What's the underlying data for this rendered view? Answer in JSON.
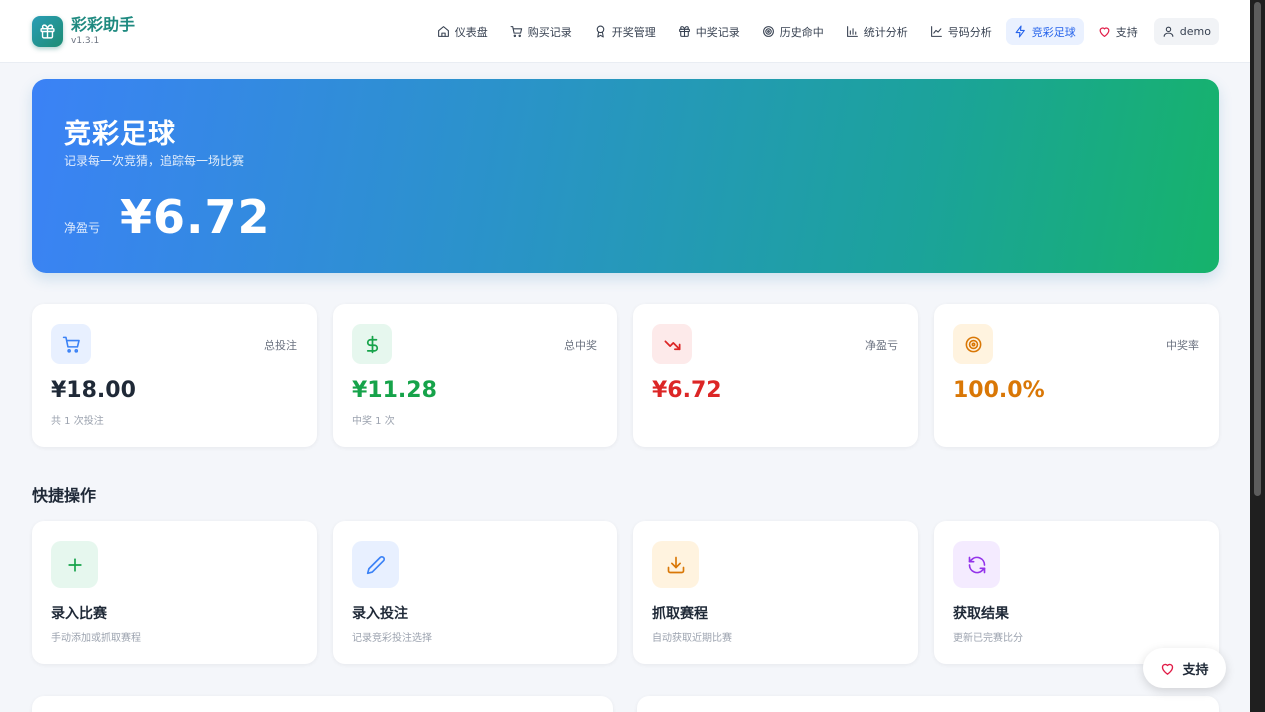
{
  "app": {
    "name": "彩彩助手",
    "version": "v1.3.1"
  },
  "nav": {
    "items": [
      {
        "label": "仪表盘",
        "icon": "home-icon"
      },
      {
        "label": "购买记录",
        "icon": "cart-icon"
      },
      {
        "label": "开奖管理",
        "icon": "award-icon"
      },
      {
        "label": "中奖记录",
        "icon": "gift-icon"
      },
      {
        "label": "历史命中",
        "icon": "target-icon"
      },
      {
        "label": "统计分析",
        "icon": "bar-chart-icon"
      },
      {
        "label": "号码分析",
        "icon": "line-chart-icon"
      },
      {
        "label": "竞彩足球",
        "icon": "lightning-icon",
        "active": true
      },
      {
        "label": "支持",
        "icon": "heart-icon"
      }
    ],
    "user": "demo"
  },
  "hero": {
    "title": "竞彩足球",
    "subtitle": "记录每一次竞猜，追踪每一场比赛",
    "net_label": "净盈亏",
    "net_value": "¥6.72"
  },
  "stats": [
    {
      "label": "总投注",
      "value": "¥18.00",
      "note": "共 1 次投注",
      "icon": "cart-icon",
      "color": "#1f2937"
    },
    {
      "label": "总中奖",
      "value": "¥11.28",
      "note": "中奖 1 次",
      "icon": "dollar-icon",
      "color": "#16a34a"
    },
    {
      "label": "净盈亏",
      "value": "¥6.72",
      "note": "",
      "icon": "trending-down-icon",
      "color": "#dc2626"
    },
    {
      "label": "中奖率",
      "value": "100.0%",
      "note": "",
      "icon": "target-icon",
      "color": "#d97706"
    }
  ],
  "quick_actions": {
    "title": "快捷操作",
    "items": [
      {
        "title": "录入比赛",
        "desc": "手动添加或抓取赛程",
        "icon": "plus-icon"
      },
      {
        "title": "录入投注",
        "desc": "记录竞彩投注选择",
        "icon": "pencil-icon"
      },
      {
        "title": "抓取赛程",
        "desc": "自动获取近期比赛",
        "icon": "download-icon"
      },
      {
        "title": "获取结果",
        "desc": "更新已完赛比分",
        "icon": "refresh-icon"
      }
    ]
  },
  "float_support": {
    "label": "支持"
  }
}
